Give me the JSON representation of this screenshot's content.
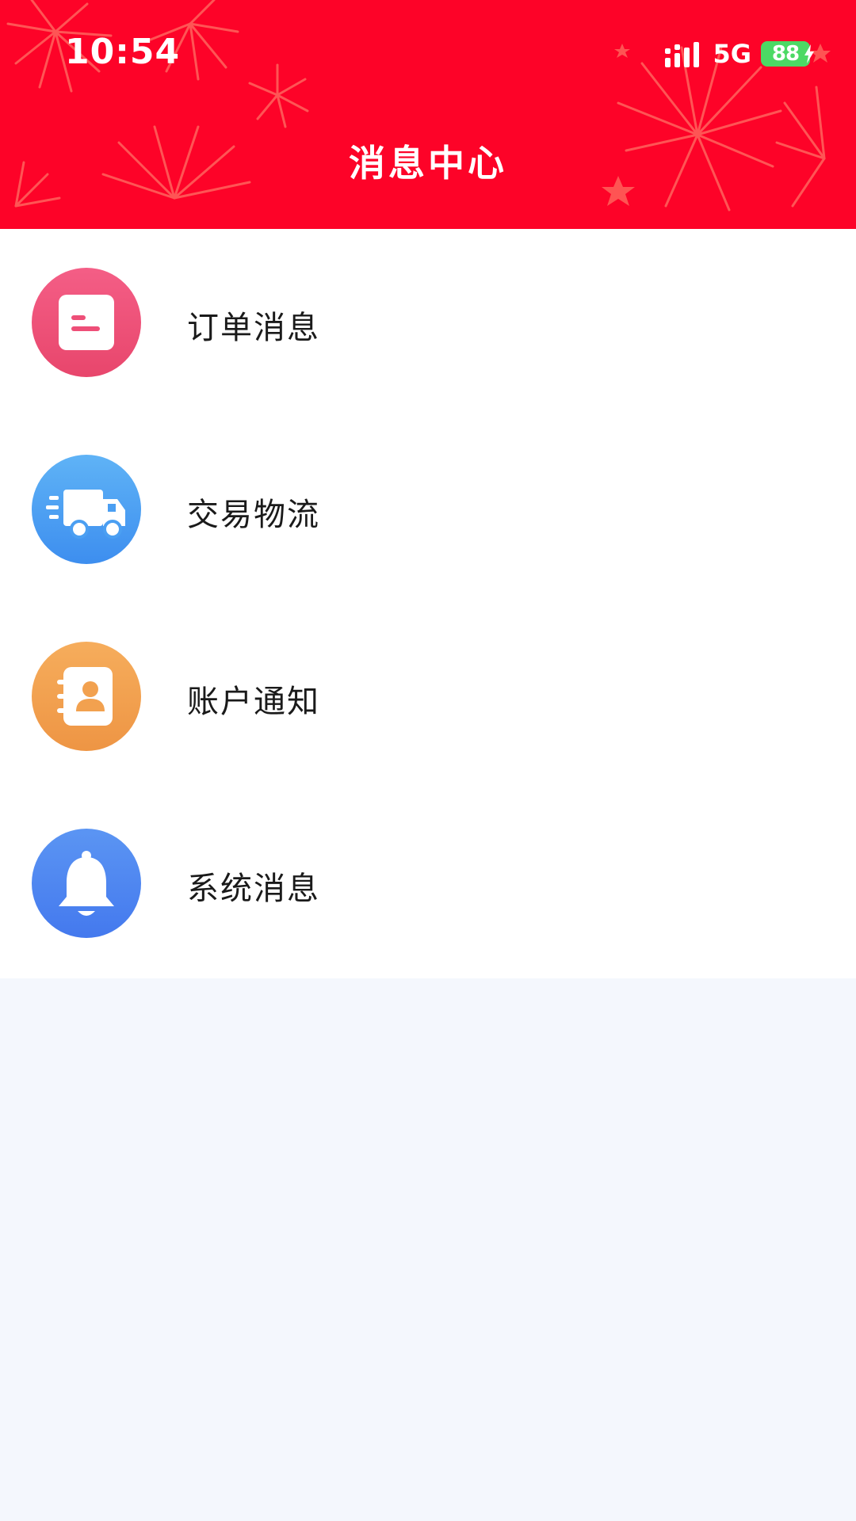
{
  "status_bar": {
    "time": "10:54",
    "network": "5G",
    "battery": "88"
  },
  "header": {
    "title": "消息中心",
    "background_color": "#fd0328"
  },
  "menu": {
    "items": [
      {
        "label": "订单消息",
        "icon": "document-icon",
        "color": "#ee4f78"
      },
      {
        "label": "交易物流",
        "icon": "truck-icon",
        "color": "#4b9ff2"
      },
      {
        "label": "账户通知",
        "icon": "contact-book-icon",
        "color": "#f2a14f"
      },
      {
        "label": "系统消息",
        "icon": "bell-icon",
        "color": "#4e86f0"
      }
    ]
  }
}
